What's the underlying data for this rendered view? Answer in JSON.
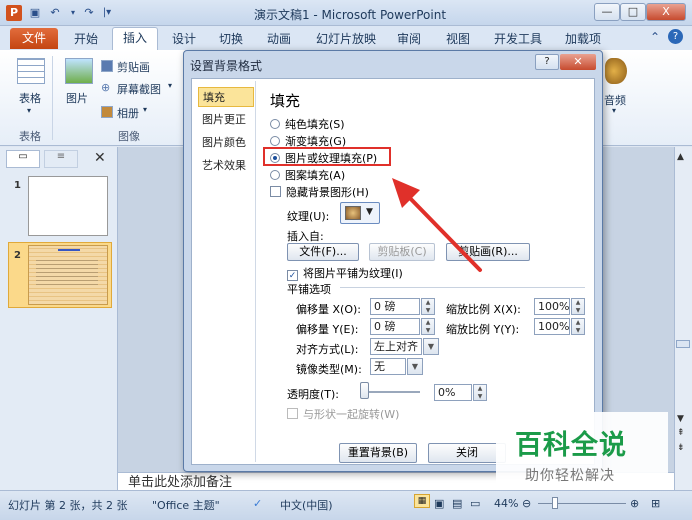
{
  "app": {
    "title": "演示文稿1 - Microsoft PowerPoint",
    "icon_letter": "P",
    "quick_access": [
      "save-icon",
      "undo-icon",
      "redo-icon"
    ]
  },
  "window_controls": {
    "minimize": "—",
    "maximize": "□",
    "close": "X"
  },
  "tabs": {
    "file": "文件",
    "items": [
      "开始",
      "插入",
      "设计",
      "切换",
      "动画",
      "幻灯片放映",
      "审阅",
      "视图",
      "开发工具",
      "加载项"
    ],
    "active": "插入"
  },
  "ribbon": {
    "table_label": "表格",
    "picture_label": "图片",
    "clipart_label": "剪贴画",
    "screenshot_label": "屏幕截图",
    "album_label": "相册",
    "audio_label": "音频",
    "group_table": "表格",
    "group_image": "图像"
  },
  "left_pane": {
    "slides": [
      {
        "number": "1"
      },
      {
        "number": "2"
      }
    ]
  },
  "notes_placeholder": "单击此处添加备注",
  "status_bar": {
    "slide_info": "幻灯片 第 2 张，共 2 张",
    "theme": "\"Office 主题\"",
    "language": "中文(中国)",
    "zoom": "44%"
  },
  "dialog": {
    "title": "设置背景格式",
    "nav": [
      "填充",
      "图片更正",
      "图片颜色",
      "艺术效果"
    ],
    "active_nav": "填充",
    "section_title": "填充",
    "fill_options": [
      {
        "label": "纯色填充(S)",
        "selected": false
      },
      {
        "label": "渐变填充(G)",
        "selected": false
      },
      {
        "label": "图片或纹理填充(P)",
        "selected": true
      },
      {
        "label": "图案填充(A)",
        "selected": false
      }
    ],
    "hide_bg_graphics": "隐藏背景图形(H)",
    "texture_label": "纹理(U):",
    "insert_from": "插入自:",
    "btn_file": "文件(F)...",
    "btn_clipboard": "剪贴板(C)",
    "btn_clipart": "剪贴画(R)...",
    "tile_checkbox": "将图片平铺为纹理(I)",
    "tile_options_label": "平铺选项",
    "offset_x_label": "偏移量 X(O):",
    "offset_x_value": "0 磅",
    "offset_y_label": "偏移量 Y(E):",
    "offset_y_value": "0 磅",
    "scale_x_label": "缩放比例 X(X):",
    "scale_x_value": "100%",
    "scale_y_label": "缩放比例 Y(Y):",
    "scale_y_value": "100%",
    "align_label": "对齐方式(L):",
    "align_value": "左上对齐",
    "mirror_label": "镜像类型(M):",
    "mirror_value": "无",
    "transparency_label": "透明度(T):",
    "transparency_value": "0%",
    "rotate_with_shape": "与形状一起旋转(W)",
    "btn_reset": "重置背景(B)",
    "btn_close": "关闭"
  },
  "watermark": {
    "line1": "百科全说",
    "line2": "助你轻松解决"
  },
  "colors": {
    "accent": "#c44512",
    "highlight": "#e0302a",
    "watermark": "#1b9b49"
  }
}
